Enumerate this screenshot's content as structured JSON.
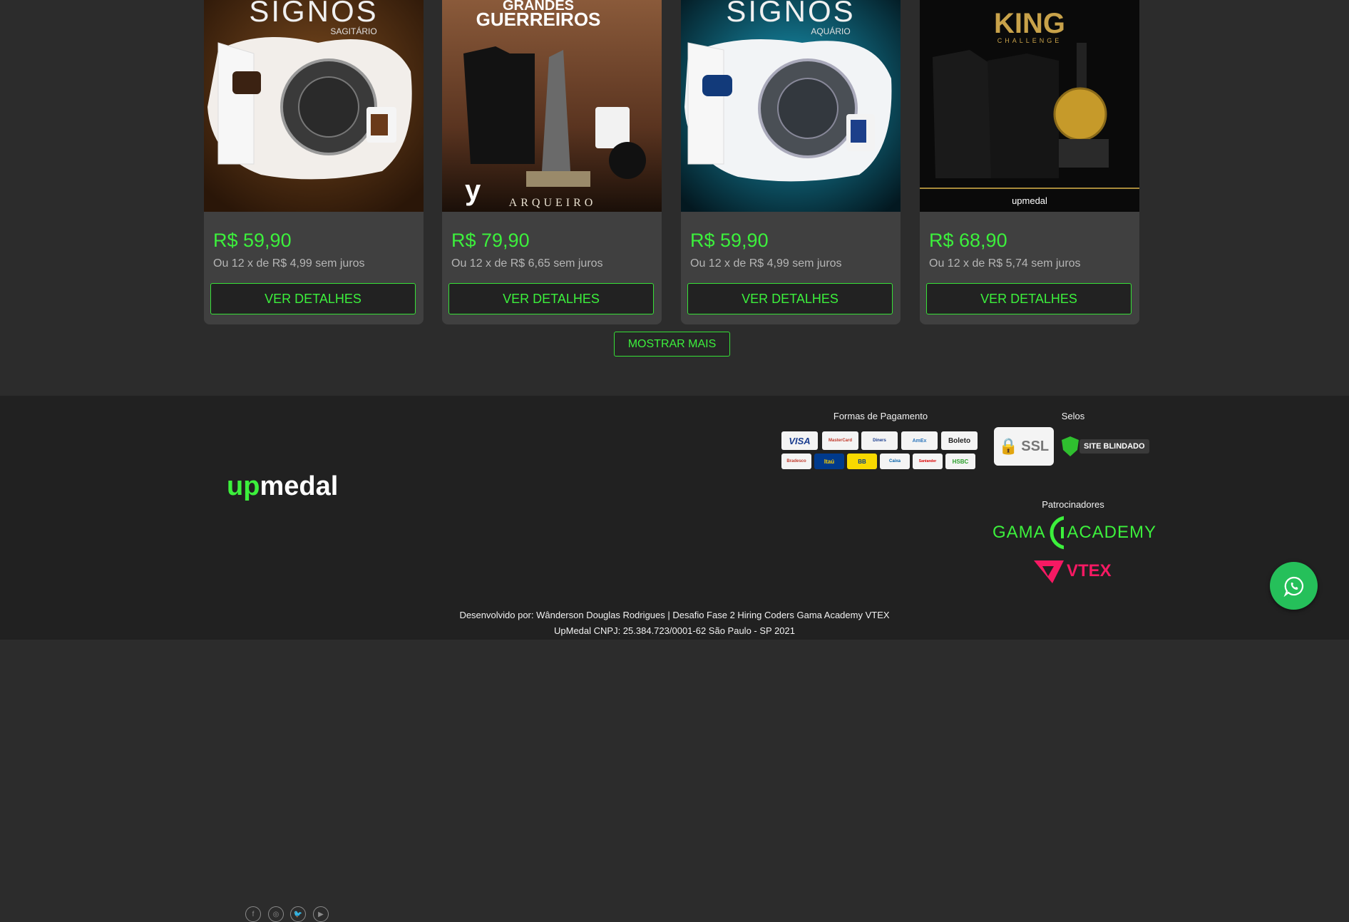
{
  "products": [
    {
      "price": "R$ 59,90",
      "installments": "Ou 12 x de R$ 4,99 sem juros",
      "button": "VER DETALHES",
      "image_title": "SIGNOS",
      "image_subtitle": "SAGITÁRIO"
    },
    {
      "price": "R$ 79,90",
      "installments": "Ou 12 x de R$ 6,65 sem juros",
      "button": "VER DETALHES",
      "image_title": "GRANDES",
      "image_title2": "GUERREIROS",
      "image_bottom": "ARQUEIRO"
    },
    {
      "price": "R$ 59,90",
      "installments": "Ou 12 x de R$ 4,99 sem juros",
      "button": "VER DETALHES",
      "image_title": "SIGNOS",
      "image_subtitle": "AQUÁRIO"
    },
    {
      "price": "R$ 68,90",
      "installments": "Ou 12 x de R$ 5,74 sem juros",
      "button": "VER DETALHES",
      "image_title": "KING",
      "image_subtitle": "CHALLENGE",
      "image_bottom": "upmedal"
    }
  ],
  "show_more": "MOSTRAR MAIS",
  "footer": {
    "brand": "upmedal",
    "social_icons": [
      "facebook-icon",
      "instagram-icon",
      "twitter-icon",
      "youtube-icon"
    ],
    "payment_title": "Formas de Pagamento",
    "payment_methods": [
      "VISA",
      "MasterCard",
      "Diners",
      "AmEx",
      "Boleto",
      "Bradesco",
      "Itaú",
      "BB",
      "Caixa",
      "Santander",
      "HSBC"
    ],
    "seals_title": "Selos",
    "ssl_text": "SSL",
    "blindado_text": "SITE BLINDADO",
    "sponsors_title": "Patrocinadores",
    "gama_left": "GAMA",
    "gama_right": "ACADEMY",
    "vtex": "VTEX",
    "credits_line1": "Desenvolvido por: Wânderson Douglas Rodrigues | Desafio Fase 2 Hiring Coders Gama Academy VTEX",
    "credits_line2": "UpMedal CNPJ: 25.384.723/0001-62 São Paulo - SP 2021"
  },
  "colors": {
    "accent": "#3cf03c",
    "page_bg": "#2c2c2c",
    "card_bg": "#404040",
    "footer_bg": "#212121",
    "whatsapp": "#25c05a"
  }
}
